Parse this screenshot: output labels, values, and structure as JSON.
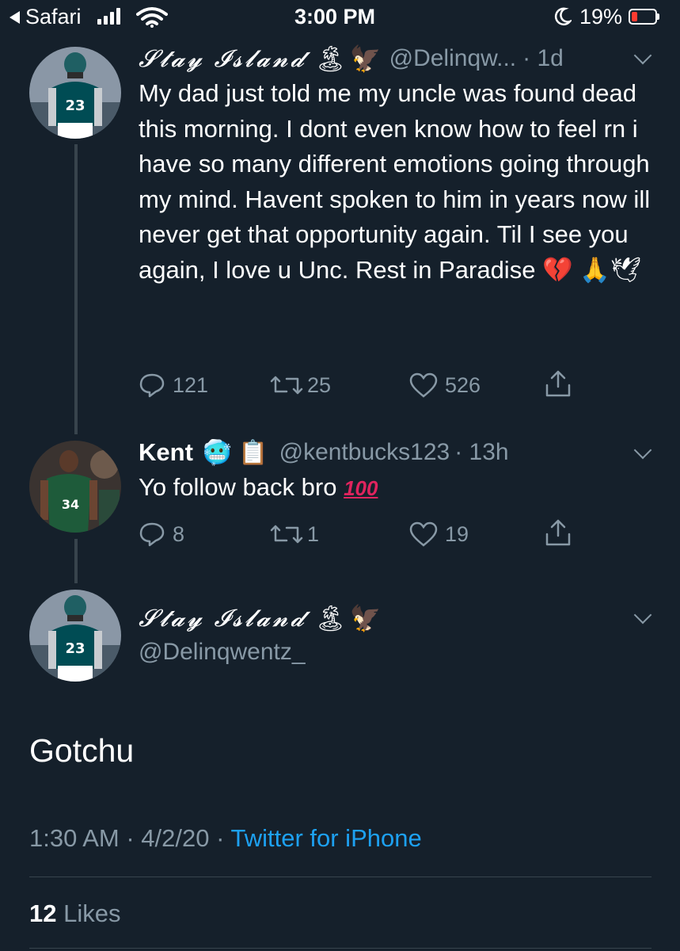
{
  "status_bar": {
    "back_app": "Safari",
    "time": "3:00 PM",
    "battery": "19%"
  },
  "tweets": [
    {
      "display_name": "𝓢𝓽𝓪𝔂 𝓘𝓼𝓵𝓪𝓷𝓭",
      "handle": "@Delinqw...",
      "time": "· 1d",
      "text": "My dad just told me my uncle was found dead this morning. I dont even know how to feel rn i have so many different emotions going through my mind. Havent spoken to him in years now ill never get that opportunity again. Til I see you again, I love u Unc. Rest in Paradise",
      "replies": "121",
      "retweets": "25",
      "likes": "526",
      "avatar_number": "23"
    },
    {
      "display_name": "Kent",
      "handle": "@kentbucks123",
      "time": "· 13h",
      "text": "Yo follow back bro",
      "replies": "8",
      "retweets": "1",
      "likes": "19",
      "avatar_number": "34"
    }
  ],
  "main_tweet": {
    "display_name": "𝓢𝓽𝓪𝔂 𝓘𝓼𝓵𝓪𝓷𝓭",
    "handle": "@Delinqwentz_",
    "text": "Gotchu",
    "timestamp": "1:30 AM · 4/2/20 ·",
    "source": "Twitter for iPhone",
    "likes_count": "12",
    "likes_label": "Likes",
    "avatar_number": "23"
  },
  "colors": {
    "background": "#15202b",
    "secondary_text": "#8899a6",
    "link": "#1da1f2",
    "divider": "#38444d",
    "battery_low": "#ff3b30"
  }
}
